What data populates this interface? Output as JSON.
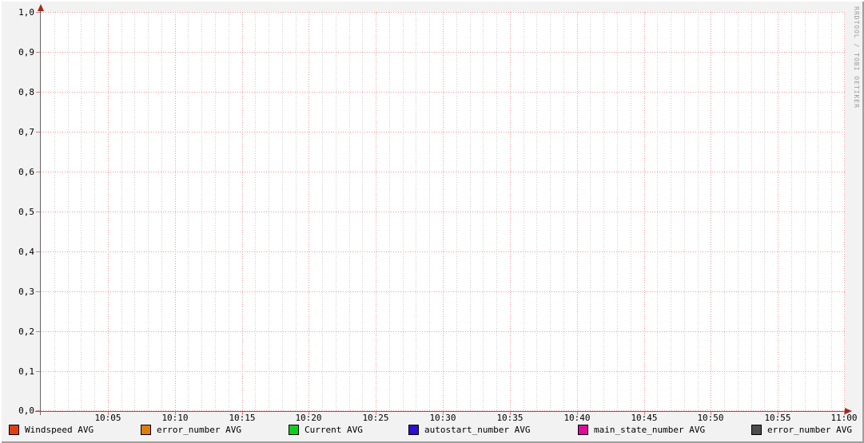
{
  "watermark": "RRDTOOL / TOBI OETIKER",
  "chart_data": {
    "type": "line",
    "title": "",
    "xlabel": "",
    "ylabel": "",
    "x_axis": {
      "start": "10:00",
      "end": "11:00",
      "tick_labels": [
        "10:05",
        "10:10",
        "10:15",
        "10:20",
        "10:25",
        "10:30",
        "10:35",
        "10:40",
        "10:45",
        "10:50",
        "10:55",
        "11:00"
      ],
      "minutes_total": 60,
      "major_step_minutes": 5,
      "minor_step_minutes": 1
    },
    "y_axis": {
      "min": 0.0,
      "max": 1.0,
      "major_step": 0.1,
      "tick_labels_top_to_bottom": [
        "1,0",
        "0,9",
        "0,8",
        "0,7",
        "0,6",
        "0,5",
        "0,4",
        "0,3",
        "0,2",
        "0,1",
        "0,0"
      ]
    },
    "grid": {
      "major_color": "#ee9a9a",
      "minor_color": "#cccccc",
      "style": "dotted",
      "grid_on": true
    },
    "legend_position": "bottom",
    "no_data_plotted": true,
    "series": [
      {
        "name": "Windspeed AVG",
        "color": "#e23d0e",
        "values": []
      },
      {
        "name": "error_number AVG",
        "color": "#df7c0a",
        "values": []
      },
      {
        "name": "Current AVG",
        "color": "#0fce1c",
        "values": []
      },
      {
        "name": "autostart_number AVG",
        "color": "#2b0fd8",
        "values": []
      },
      {
        "name": "main_state_number AVG",
        "color": "#dd0a9a",
        "values": []
      },
      {
        "name": "error_number AVG",
        "color": "#4d4d4d",
        "values": []
      }
    ]
  },
  "legend": {
    "items": [
      {
        "label": "Windspeed AVG",
        "color": "#e23d0e"
      },
      {
        "label": "error_number AVG",
        "color": "#df7c0a"
      },
      {
        "label": "Current AVG",
        "color": "#0fce1c"
      },
      {
        "label": "autostart_number AVG",
        "color": "#2b0fd8"
      },
      {
        "label": "main_state_number AVG",
        "color": "#dd0a9a"
      },
      {
        "label": "error_number AVG",
        "color": "#4d4d4d"
      }
    ]
  },
  "colors": {
    "background": "#f2f2f2",
    "canvas": "#ffffff",
    "axis": "#666666",
    "arrow": "#a5281c",
    "tick": "#dd8080",
    "text": "#000000",
    "watermark_text": "#9c9c9c",
    "bevel_light": "#ffffff",
    "bevel_dark": "#9e9e9e"
  }
}
